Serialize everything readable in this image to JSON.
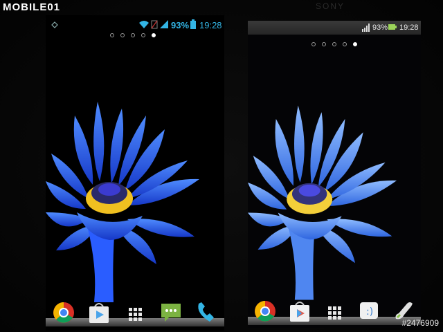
{
  "watermark": {
    "text": "MOBILE01"
  },
  "brand": {
    "text": "SONY"
  },
  "photo_id": {
    "text": "#2476909"
  },
  "colors": {
    "petal": "#1e5bff",
    "petal_light": "#5aa0ff",
    "stamen": "#f0c020",
    "background": "#050505"
  },
  "phones": {
    "left": {
      "battery": "93%",
      "time": "19:28",
      "pages": 5,
      "active_page": 5,
      "dock": [
        "chrome-icon",
        "play-store-icon",
        "app-drawer-icon",
        "messaging-icon",
        "phone-icon"
      ]
    },
    "right": {
      "battery": "93%",
      "time": "19:28",
      "pages": 5,
      "active_page": 5,
      "dock": [
        "chrome-icon",
        "play-store-icon",
        "app-drawer-icon",
        "messaging-icon",
        "phone-icon"
      ]
    }
  }
}
